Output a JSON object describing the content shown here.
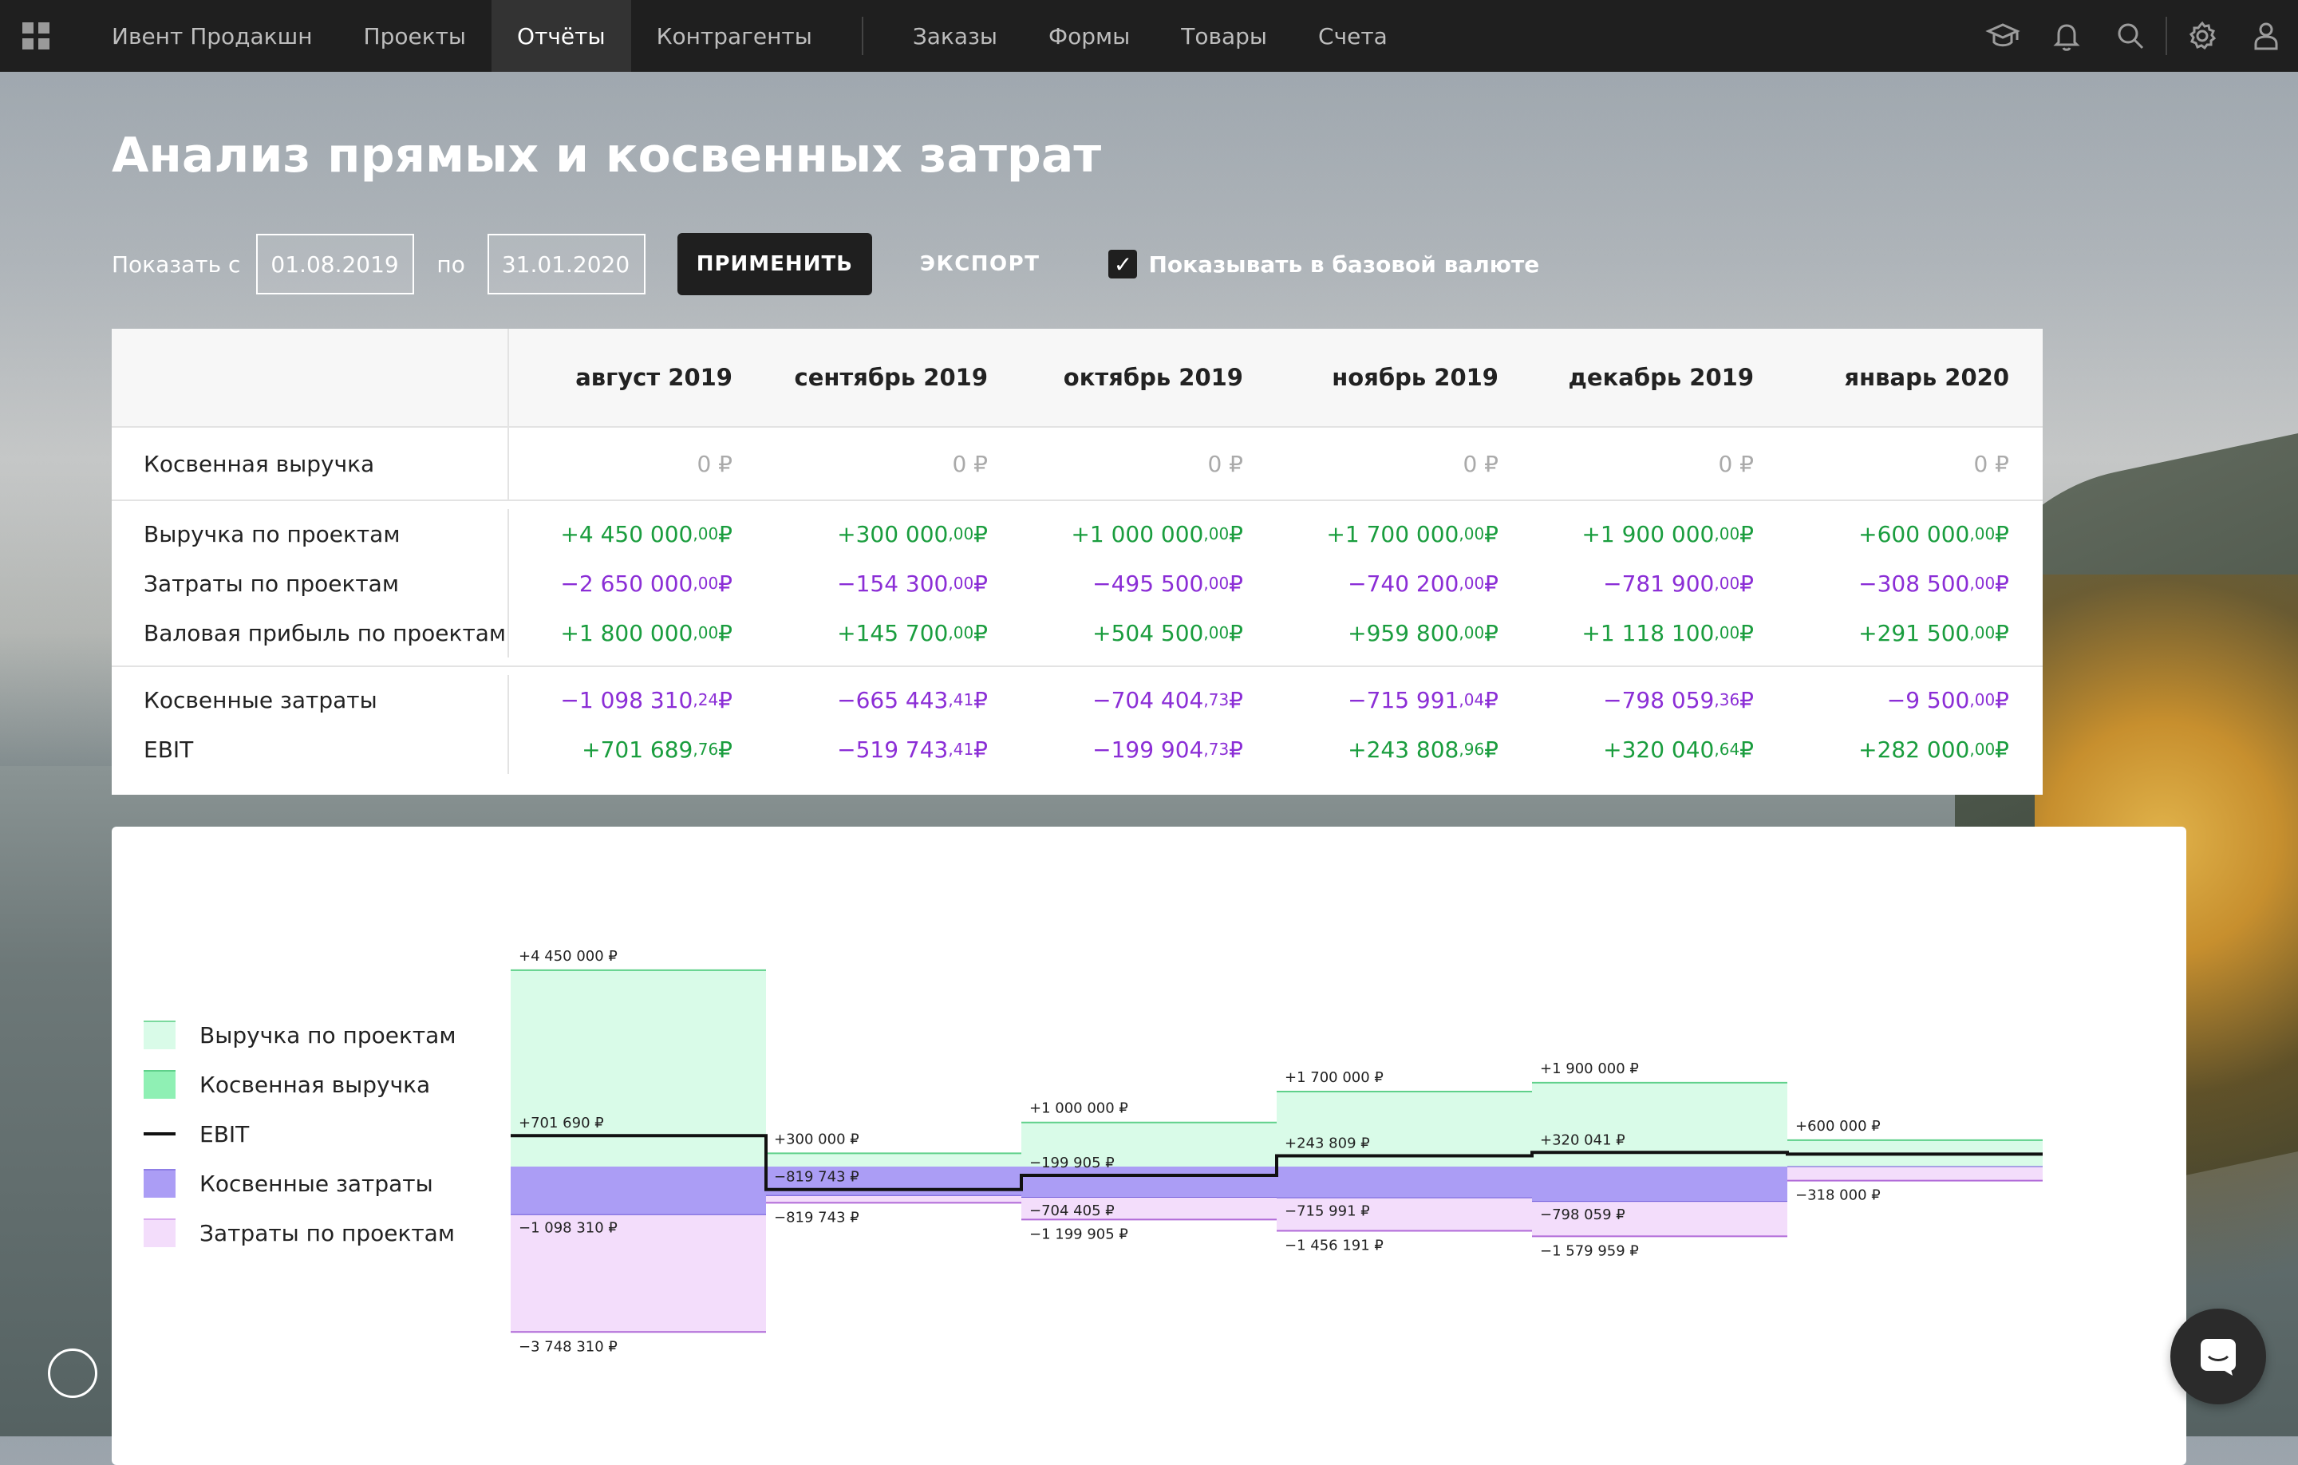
{
  "nav": {
    "company": "Ивент Продакшн",
    "items": [
      "Проекты",
      "Отчёты",
      "Контрагенты"
    ],
    "items2": [
      "Заказы",
      "Формы",
      "Товары",
      "Счета"
    ],
    "icons": [
      "graduation-cap-icon",
      "bell-icon",
      "search-icon",
      "gear-icon",
      "user-icon"
    ]
  },
  "page": {
    "title": "Анализ прямых и косвенных затрат"
  },
  "filters": {
    "from_label": "Показать с",
    "from_value": "01.08.2019",
    "to_label": "по",
    "to_value": "31.01.2020",
    "apply": "ПРИМЕНИТЬ",
    "export": "ЭКСПОРТ",
    "base_currency_label": "Показывать в базовой валюте",
    "base_currency_checked": true
  },
  "table": {
    "months": [
      "август 2019",
      "сентябрь 2019",
      "октябрь 2019",
      "ноябрь 2019",
      "декабрь 2019",
      "январь 2020"
    ],
    "indirect_revenue": {
      "label": "Косвенная выручка",
      "values": [
        "0 ₽",
        "0 ₽",
        "0 ₽",
        "0 ₽",
        "0 ₽",
        "0 ₽"
      ]
    },
    "project_revenue": {
      "label": "Выручка по проектам",
      "values": [
        {
          "int": "+4 450 000",
          "dec": "00"
        },
        {
          "int": "+300 000",
          "dec": "00"
        },
        {
          "int": "+1 000 000",
          "dec": "00"
        },
        {
          "int": "+1 700 000",
          "dec": "00"
        },
        {
          "int": "+1 900 000",
          "dec": "00"
        },
        {
          "int": "+600 000",
          "dec": "00"
        }
      ]
    },
    "project_costs": {
      "label": "Затраты по проектам",
      "values": [
        {
          "int": "−2 650 000",
          "dec": "00"
        },
        {
          "int": "−154 300",
          "dec": "00"
        },
        {
          "int": "−495 500",
          "dec": "00"
        },
        {
          "int": "−740 200",
          "dec": "00"
        },
        {
          "int": "−781 900",
          "dec": "00"
        },
        {
          "int": "−308 500",
          "dec": "00"
        }
      ]
    },
    "gross_profit": {
      "label": "Валовая прибыль по проектам",
      "values": [
        {
          "int": "+1 800 000",
          "dec": "00"
        },
        {
          "int": "+145 700",
          "dec": "00"
        },
        {
          "int": "+504 500",
          "dec": "00"
        },
        {
          "int": "+959 800",
          "dec": "00"
        },
        {
          "int": "+1 118 100",
          "dec": "00"
        },
        {
          "int": "+291 500",
          "dec": "00"
        }
      ]
    },
    "indirect_costs": {
      "label": "Косвенные затраты",
      "values": [
        {
          "int": "−1 098 310",
          "dec": "24"
        },
        {
          "int": "−665 443",
          "dec": "41"
        },
        {
          "int": "−704 404",
          "dec": "73"
        },
        {
          "int": "−715 991",
          "dec": "04"
        },
        {
          "int": "−798 059",
          "dec": "36"
        },
        {
          "int": "−9 500",
          "dec": "00"
        }
      ]
    },
    "ebit": {
      "label": "EBIT",
      "values": [
        {
          "int": "+701 689",
          "dec": "76"
        },
        {
          "int": "−519 743",
          "dec": "41"
        },
        {
          "int": "−199 904",
          "dec": "73"
        },
        {
          "int": "+243 808",
          "dec": "96"
        },
        {
          "int": "+320 040",
          "dec": "64"
        },
        {
          "int": "+282 000",
          "dec": "00"
        }
      ]
    },
    "currency": "₽"
  },
  "legend": [
    {
      "label": "Выручка по проектам",
      "color": "#d9fbe8",
      "border": "#7ad99d"
    },
    {
      "label": "Косвенная выручка",
      "color": "#8ff0b4",
      "border": "#5fd08a"
    },
    {
      "label": "EBIT",
      "line": true
    },
    {
      "label": "Косвенные затраты",
      "color": "#ab9df5",
      "border": "#8f7fe6"
    },
    {
      "label": "Затраты по проектам",
      "color": "#f3ddfb",
      "border": "#d9a9ee"
    }
  ],
  "chart_data": {
    "type": "bar",
    "categories": [
      "август 2019",
      "сентябрь 2019",
      "октябрь 2019",
      "ноябрь 2019",
      "декабрь 2019",
      "январь 2020"
    ],
    "series": [
      {
        "name": "Выручка по проектам",
        "values": [
          4450000,
          300000,
          1000000,
          1700000,
          1900000,
          600000
        ]
      },
      {
        "name": "Косвенная выручка",
        "values": [
          0,
          0,
          0,
          0,
          0,
          0
        ]
      },
      {
        "name": "Косвенные затраты",
        "values": [
          -1098310,
          -665443,
          -704405,
          -715991,
          -798059,
          -9500
        ]
      },
      {
        "name": "Затраты по проектам",
        "values": [
          -2650000,
          -154300,
          -495500,
          -740200,
          -781900,
          -308500
        ]
      },
      {
        "name": "EBIT",
        "values": [
          701690,
          -519743,
          -199905,
          243809,
          320041,
          282000
        ]
      }
    ],
    "labels": {
      "top": [
        "+4 450 000 ₽",
        "+300 000 ₽",
        "+1 000 000 ₽",
        "+1 700 000 ₽",
        "+1 900 000 ₽",
        "+600 000 ₽"
      ],
      "ebit": [
        "+701 690 ₽",
        "−819 743 ₽",
        "−199 905 ₽",
        "+243 809 ₽",
        "+320 041 ₽",
        ""
      ],
      "indirect": [
        "−1 098 310 ₽",
        "",
        "−704 405 ₽",
        "−715 991 ₽",
        "−798 059 ₽",
        ""
      ],
      "bottom": [
        "−3 748 310 ₽",
        "−819 743 ₽",
        "−1 199 905 ₽",
        "−1 456 191 ₽",
        "−1 579 959 ₽",
        "−318 000 ₽"
      ]
    }
  }
}
